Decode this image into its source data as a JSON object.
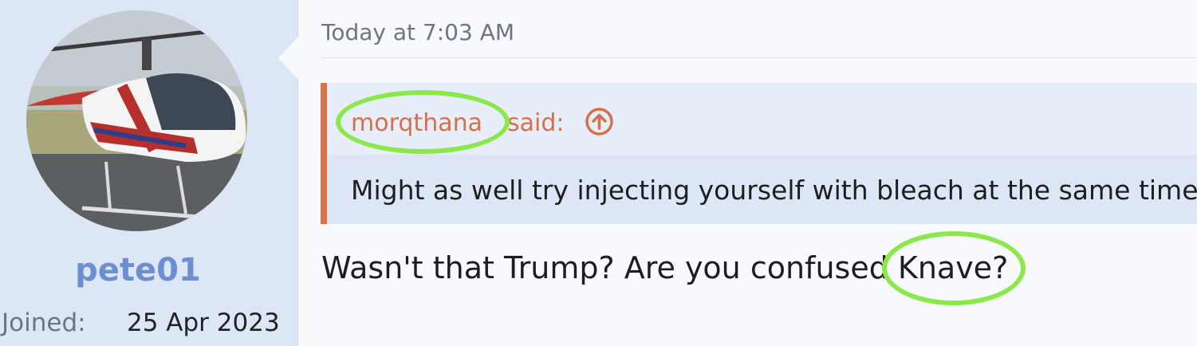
{
  "user": {
    "avatar": "helicopter-photo",
    "username": "pete01",
    "joined_label": "Joined:",
    "joined_value": "25 Apr 2023"
  },
  "post": {
    "timestamp": "Today at 7:03 AM",
    "quote": {
      "author": "morqthana",
      "said": "said:",
      "icon": "arrow-up-circle-icon",
      "text": "Might as well try injecting yourself with bleach at the same time."
    },
    "reply": "Wasn't that Trump? Are you confused Knave?"
  },
  "colors": {
    "accent": "#d9734a",
    "username": "#6d8ecf",
    "highlight": "#8be84a"
  }
}
